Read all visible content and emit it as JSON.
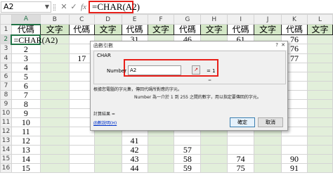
{
  "formula_bar": {
    "name_box": "A2",
    "cancel_icon": "✕",
    "enter_icon": "✓",
    "fx_icon": "fx",
    "formula": "=CHAR(A2)"
  },
  "columns": [
    "A",
    "B",
    "C",
    "D",
    "E",
    "F",
    "G",
    "H",
    "I",
    "J",
    "K",
    "L"
  ],
  "rows": [
    "1",
    "2",
    "3",
    "4",
    "5",
    "6",
    "7",
    "8",
    "9",
    "10",
    "11",
    "12",
    "13",
    "14",
    "15",
    "16"
  ],
  "header_row": [
    "代碼",
    "文字",
    "代碼",
    "文字",
    "代碼",
    "文字",
    "代碼",
    "文字",
    "代碼",
    "文字",
    "代碼",
    "文字"
  ],
  "cells": {
    "A2": "=CHAR(A2)",
    "A": [
      "2",
      "3",
      "4",
      "5",
      "6",
      "7",
      "8",
      "9",
      "10",
      "11",
      "12",
      "13",
      "14",
      "15"
    ],
    "C": [
      "",
      "17",
      "",
      "",
      "",
      "",
      "",
      "",
      "",
      "",
      "",
      "",
      "",
      ""
    ],
    "E": [
      "",
      "",
      "",
      "",
      "",
      "",
      "",
      "",
      "",
      "",
      "41",
      "42",
      "43",
      "44"
    ],
    "G": [
      "",
      "",
      "",
      "",
      "",
      "",
      "",
      "",
      "",
      "",
      "",
      "57",
      "58",
      "59"
    ],
    "I": [
      "",
      "",
      "",
      "",
      "",
      "",
      "",
      "",
      "",
      "",
      "",
      "",
      "74",
      "75"
    ],
    "K": [
      "76",
      "77",
      "",
      "",
      "",
      "",
      "",
      "",
      "",
      "",
      "",
      "",
      "90",
      "91"
    ]
  },
  "partial_rows": {
    "E": "31",
    "G": "46",
    "I": "61",
    "K": "76"
  },
  "dialog": {
    "title": "函數引數",
    "help": "?",
    "close": "✕",
    "function_name": "CHAR",
    "arg_label": "Number",
    "arg_value": "A2",
    "arg_result": "= 1",
    "func_result": "=",
    "description": "根據您電腦的字元集，傳回代碼所對應的字元。",
    "arg_description": "Number   為一介於 1 到 255 之間的數字，用以指定要傳回的字元。",
    "result_label": "計算結果 =",
    "help_link": "函數說明(H)",
    "ok": "確定",
    "cancel": "取消"
  }
}
